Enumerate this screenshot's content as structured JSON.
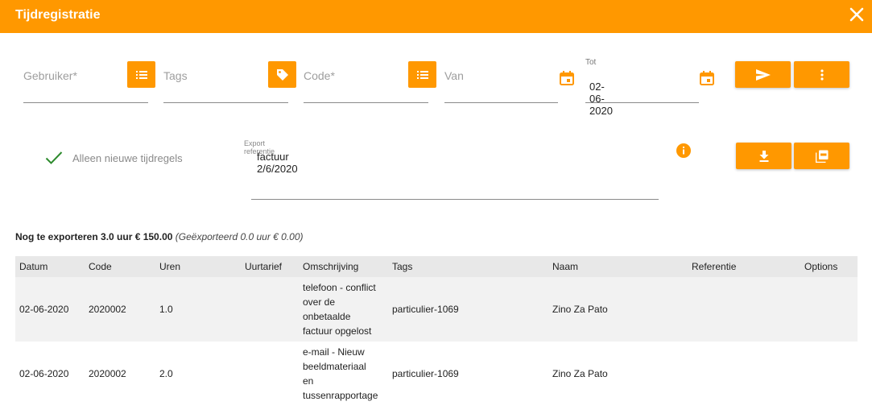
{
  "window": {
    "title": "Tijdregistratie",
    "accent": "#ff9800"
  },
  "filters": {
    "gebruiker_placeholder": "Gebruiker*",
    "tags_placeholder": "Tags",
    "code_placeholder": "Code*",
    "van_placeholder": "Van",
    "tot_label": "Tot",
    "tot_value": "02-06-2020"
  },
  "export": {
    "alleen_nieuwe_label": "Alleen nieuwe tijdregels",
    "referentie_label": "Export referentie",
    "referentie_value": "factuur 2/6/2020"
  },
  "summary": {
    "main": "Nog te exporteren 3.0 uur € 150.00",
    "sub": "(Geëxporteerd 0.0 uur € 0.00)"
  },
  "table": {
    "headers": [
      "Datum",
      "Code",
      "Uren",
      "Uurtarief",
      "Omschrijving",
      "Tags",
      "Naam",
      "Referentie",
      "Options"
    ],
    "rows": [
      {
        "datum": "02-06-2020",
        "code": "2020002",
        "uren": "1.0",
        "uurtarief": "",
        "omschrijving": [
          "telefoon - conflict",
          "over de",
          "onbetaalde",
          "factuur opgelost"
        ],
        "tags": "particulier-1069",
        "naam": "Zino Za Pato",
        "referentie": "",
        "options": ""
      },
      {
        "datum": "02-06-2020",
        "code": "2020002",
        "uren": "2.0",
        "uurtarief": "",
        "omschrijving": [
          "e-mail - Nieuw",
          "beeldmateriaal",
          "en",
          "tussenrapportage"
        ],
        "tags": "particulier-1069",
        "naam": "Zino Za Pato",
        "referentie": "",
        "options": ""
      }
    ]
  }
}
